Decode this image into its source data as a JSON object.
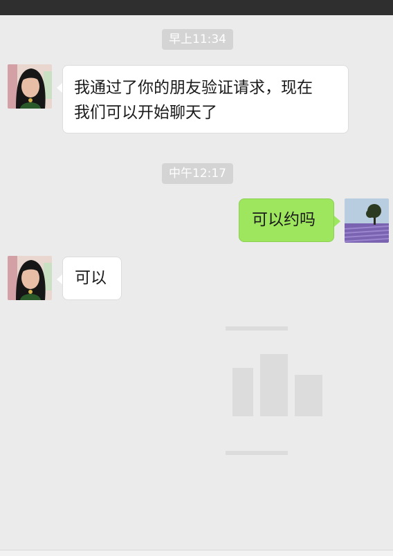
{
  "chat": {
    "messages": [
      {
        "type": "timestamp",
        "text": "早上11:34"
      },
      {
        "type": "incoming",
        "sender_avatar": "woman-portrait-avatar",
        "text_lines": [
          "我通过了你的朋友验证请求，现在",
          "我们可以开始聊天了"
        ]
      },
      {
        "type": "timestamp",
        "text": "中午12:17"
      },
      {
        "type": "outgoing",
        "sender_avatar": "lavender-field-tree-avatar",
        "text": "可以约吗"
      },
      {
        "type": "incoming",
        "sender_avatar": "woman-portrait-avatar",
        "text": "可以"
      }
    ]
  },
  "colors": {
    "background": "#ebebeb",
    "status_bar": "#2f2f2f",
    "timestamp_pill": "#d4d4d4",
    "incoming_bubble": "#ffffff",
    "outgoing_bubble": "#9ee65e"
  }
}
